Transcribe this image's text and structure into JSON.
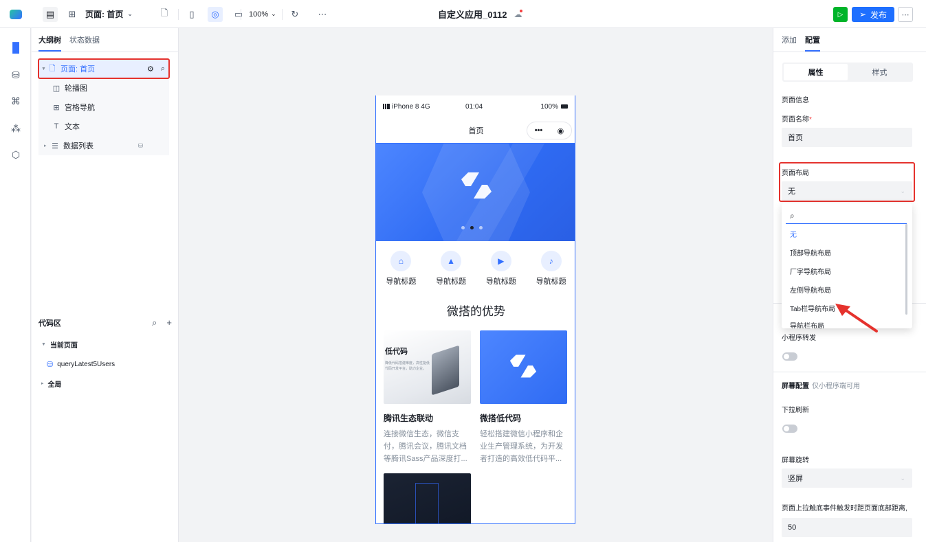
{
  "topbar": {
    "page_selector": "页面: 首页",
    "zoom": "100%",
    "app_title": "自定义应用_0112",
    "publish_label": "发布"
  },
  "left_panel": {
    "tabs": [
      "大纲树",
      "状态数据"
    ],
    "tree": [
      {
        "label": "页面: 首页",
        "icon": "page-icon"
      },
      {
        "label": "轮播图",
        "icon": "carousel-icon"
      },
      {
        "label": "宫格导航",
        "icon": "grid-icon"
      },
      {
        "label": "文本",
        "icon": "text-icon"
      },
      {
        "label": "数据列表",
        "icon": "list-icon"
      }
    ],
    "code_area": {
      "title": "代码区",
      "current_page": "当前页面",
      "query": "queryLatest5Users",
      "global": "全局"
    }
  },
  "phone": {
    "carrier": "iPhone 8 4G",
    "time": "01:04",
    "battery": "100%",
    "nav_title": "首页",
    "grid_items": [
      "导航标题",
      "导航标题",
      "导航标题",
      "导航标题"
    ],
    "section_title": "微搭的优势",
    "cards": [
      {
        "img_title": "低代码",
        "img_sub": "降低代码搭建难度，高性能低代码开发平台，助力企业。",
        "title": "腾讯生态联动",
        "desc": "连接微信生态，微信支付，腾讯会议，腾讯文档等腾讯Sass产品深度打..."
      },
      {
        "title": "微搭低代码",
        "desc": "轻松搭建微信小程序和企业生产管理系统，为开发者打造的高效低代码平..."
      }
    ]
  },
  "right_panel": {
    "tabs": [
      "添加",
      "配置"
    ],
    "segment": [
      "属性",
      "样式"
    ],
    "page_info": "页面信息",
    "page_name_label": "页面名称",
    "page_name_value": "首页",
    "layout_label": "页面布局",
    "layout_value": "无",
    "dropdown_options": [
      "无",
      "顶部导航布局",
      "厂字导航布局",
      "左侧导航布局",
      "Tab栏导航布局",
      "导航栏布局"
    ],
    "mini_share_label": "小程序转发",
    "screen_config_label": "屏幕配置",
    "screen_config_hint": "仅小程序端可用",
    "pull_refresh_label": "下拉刷新",
    "rotation_label": "屏幕旋转",
    "rotation_value": "竖屏",
    "reach_bottom_label": "页面上拉触底事件触发时距页面底部距离,",
    "reach_bottom_value": "50"
  },
  "colors": {
    "accent": "#3370ff",
    "highlight": "#e5322d",
    "run": "#00b42a"
  }
}
